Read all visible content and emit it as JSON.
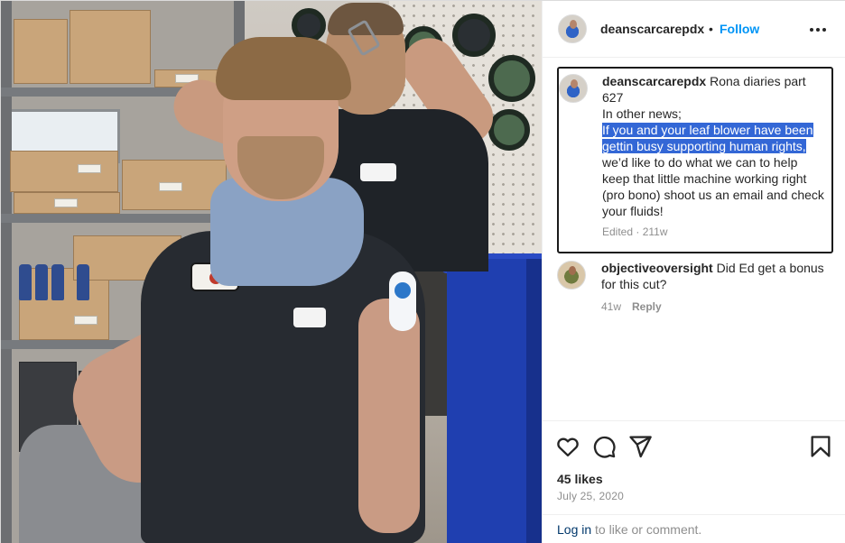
{
  "post": {
    "author": "deanscarcarepdx",
    "header_separator": "•",
    "follow_label": "Follow",
    "more_icon": "more-horizontal-icon"
  },
  "caption": {
    "author": "deanscarcarepdx",
    "intro": "Rona diaries part 627",
    "line2": "In other news;",
    "highlighted": "If you and your leaf blower have been gettin busy supporting human rights,",
    "rest": "we’d like to do what we can to help keep that little machine working right (pro bono) shoot us an email and check your fluids!",
    "edited": "Edited · 211w",
    "highlight_color": "#3367d6"
  },
  "comments": [
    {
      "author": "objectiveoversight",
      "text": "Did Ed get a bonus for this cut?",
      "age": "41w",
      "reply_label": "Reply"
    }
  ],
  "actions": {
    "like_icon": "heart-icon",
    "comment_icon": "comment-icon",
    "share_icon": "send-icon",
    "save_icon": "bookmark-icon",
    "likes": "45 likes",
    "date": "July 25, 2020"
  },
  "footer": {
    "login_label": "Log in",
    "login_rest": "to like or comment."
  },
  "colors": {
    "accent": "#0095f6",
    "text": "#262626",
    "muted": "#8e8e8e",
    "link": "#00376b"
  }
}
